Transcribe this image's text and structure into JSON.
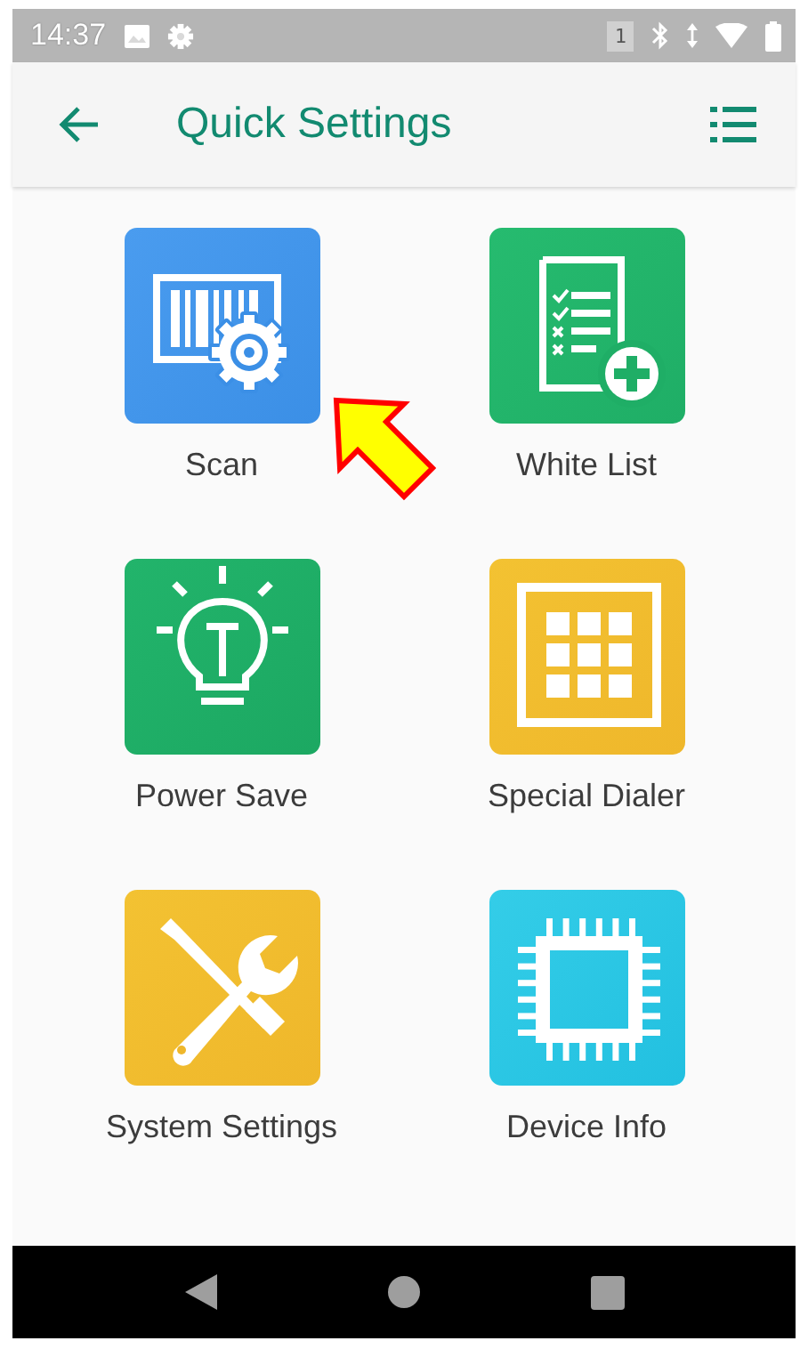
{
  "status_bar": {
    "time": "14:37",
    "sim_badge": "1"
  },
  "app_bar": {
    "title": "Quick Settings"
  },
  "tiles": [
    {
      "kind": "scan",
      "label": "Scan"
    },
    {
      "kind": "whitelist",
      "label": "White List"
    },
    {
      "kind": "power",
      "label": "Power Save"
    },
    {
      "kind": "dialer",
      "label": "Special Dialer"
    },
    {
      "kind": "tools",
      "label": "System Settings"
    },
    {
      "kind": "chip",
      "label": "Device Info"
    }
  ]
}
